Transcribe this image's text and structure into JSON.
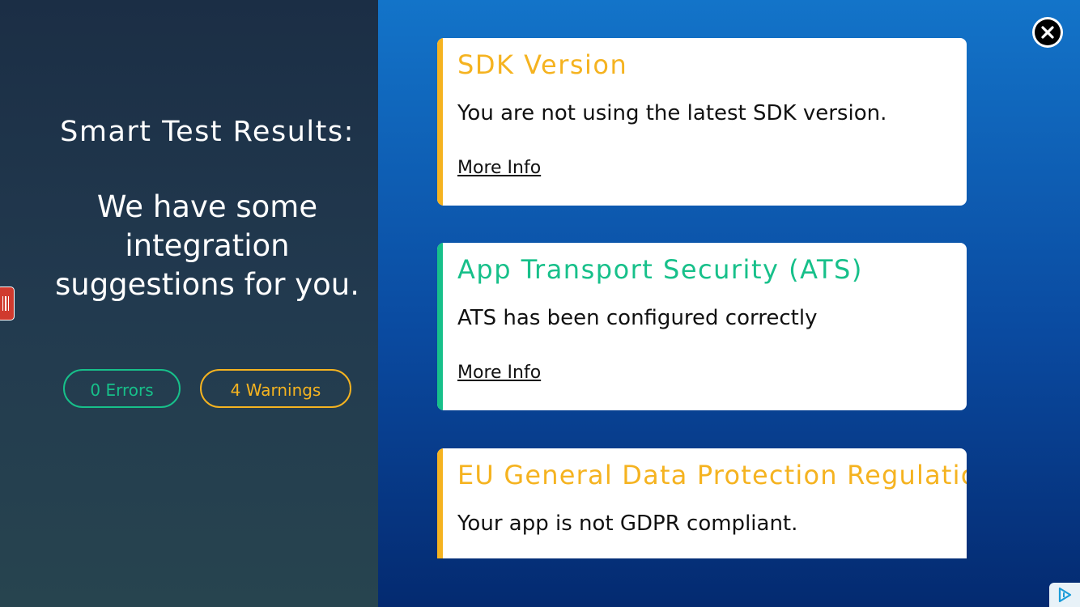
{
  "left": {
    "title": "Smart Test Results:",
    "subtitle": "We have some integration suggestions for you.",
    "errors_label": "0 Errors",
    "warnings_label": "4 Warnings"
  },
  "cards": [
    {
      "title": "SDK Version",
      "body": "You are not using the latest SDK version.",
      "link": "More Info",
      "status": "warning",
      "color": "#f5b320"
    },
    {
      "title": "App Transport Security (ATS)",
      "body": "ATS has been configured correctly",
      "link": "More Info",
      "status": "ok",
      "color": "#17c08a"
    },
    {
      "title": "EU General Data Protection Regulation",
      "body": "Your app is not GDPR compliant.",
      "status": "warning",
      "color": "#f5b320"
    }
  ],
  "colors": {
    "success": "#17c08a",
    "warning": "#f5b320",
    "drawer_handle": "#d03a2e"
  },
  "icons": {
    "close": "close-icon",
    "drawer": "drawer-handle-icon",
    "ad_choices": "ad-choices-icon"
  }
}
